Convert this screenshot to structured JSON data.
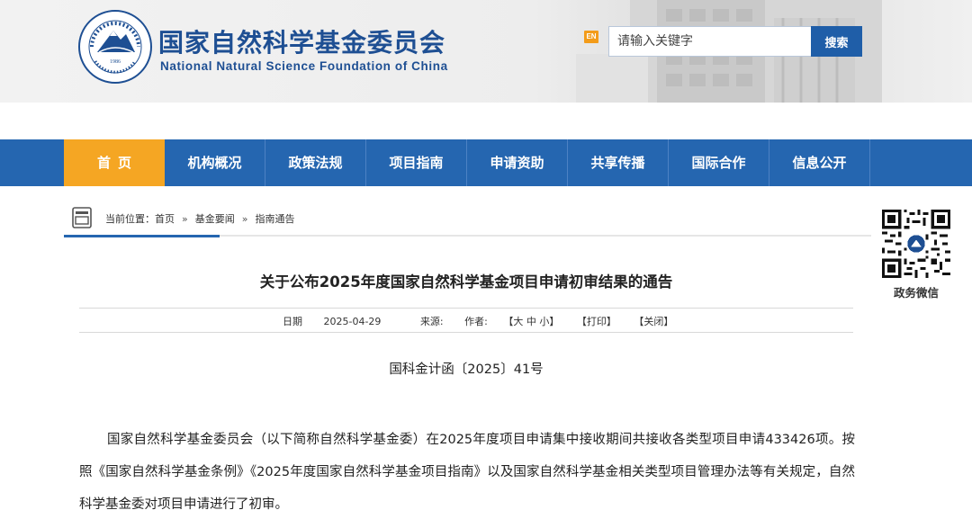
{
  "header": {
    "title_cn": "国家自然科学基金委员会",
    "title_en": "National Natural Science Foundation of China",
    "logo_year": "1986",
    "en_badge": "EN",
    "search_placeholder": "请输入关键字",
    "search_button": "搜索"
  },
  "nav": {
    "items": [
      {
        "label": "首页",
        "active": true
      },
      {
        "label": "机构概况"
      },
      {
        "label": "政策法规"
      },
      {
        "label": "项目指南"
      },
      {
        "label": "申请资助"
      },
      {
        "label": "共享传播"
      },
      {
        "label": "国际合作"
      },
      {
        "label": "信息公开"
      }
    ]
  },
  "breadcrumb": {
    "prefix": "当前位置：",
    "items": [
      "首页",
      "基金要闻",
      "指南通告"
    ],
    "separator": "»"
  },
  "article": {
    "title": "关于公布2025年度国家自然科学基金项目申请初审结果的通告",
    "meta": {
      "date_label": "日期",
      "date": "2025-04-29",
      "source_label": "来源:",
      "author_label": "作者:",
      "font_size_label": "【大 中 小】",
      "print_label": "【打印】",
      "close_label": "【关闭】"
    },
    "doc_number": "国科金计函〔2025〕41号",
    "paragraph": "国家自然科学基金委员会（以下简称自然科学基金委）在2025年度项目申请集中接收期间共接收各类型项目申请433426项。按照《国家自然科学基金条例》《2025年度国家自然科学基金项目指南》以及国家自然科学基金相关类型项目管理办法等有关规定，自然科学基金委对项目申请进行了初审。"
  },
  "sidebar": {
    "qr_label": "政务微信"
  },
  "colors": {
    "brand_blue": "#1e4f93",
    "nav_blue": "#2566b0",
    "nav_active": "#f5a623",
    "en_badge": "#f39c1a"
  }
}
